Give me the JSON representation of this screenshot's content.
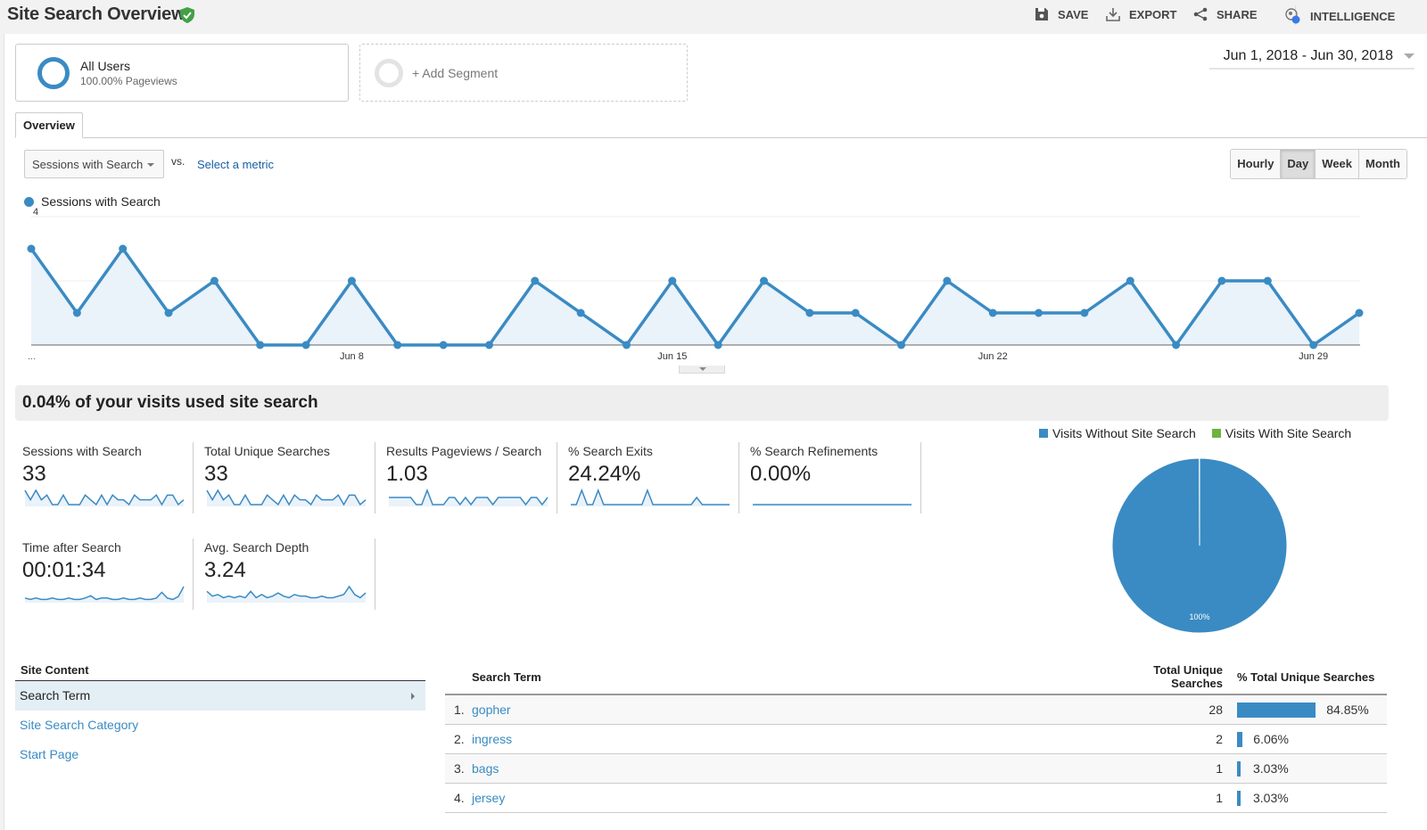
{
  "header": {
    "title": "Site Search Overview",
    "actions": [
      {
        "label": "SAVE",
        "icon": "save-icon"
      },
      {
        "label": "EXPORT",
        "icon": "export-icon"
      },
      {
        "label": "SHARE",
        "icon": "share-icon"
      },
      {
        "label": "INTELLIGENCE",
        "icon": "intelligence-icon"
      }
    ]
  },
  "segments": {
    "primary": {
      "name": "All Users",
      "sub": "100.00% Pageviews"
    },
    "add_label": "+ Add Segment"
  },
  "date_range": "Jun 1, 2018 - Jun 30, 2018",
  "tabs": {
    "overview": "Overview"
  },
  "metric_picker": {
    "selected": "Sessions with Search",
    "vs": "VS.",
    "select_metric": "Select a metric"
  },
  "period_buttons": [
    {
      "label": "Hourly",
      "active": false
    },
    {
      "label": "Day",
      "active": true
    },
    {
      "label": "Week",
      "active": false
    },
    {
      "label": "Month",
      "active": false
    }
  ],
  "colors": {
    "accent": "#3a8bc3",
    "area": "#eaf2fa",
    "green": "#6db33f",
    "link": "#1a5fa6"
  },
  "chart_data": [
    {
      "type": "area",
      "title": "",
      "legend": [
        "Sessions with Search"
      ],
      "x_start_label": "...",
      "x_tick_labels": [
        {
          "index": 7,
          "label": "Jun 8"
        },
        {
          "index": 14,
          "label": "Jun 15"
        },
        {
          "index": 21,
          "label": "Jun 22"
        },
        {
          "index": 28,
          "label": "Jun 29"
        }
      ],
      "y_ticks": [
        2,
        4
      ],
      "ylim": [
        0,
        4
      ],
      "x": [
        "Jun 1",
        "Jun 2",
        "Jun 3",
        "Jun 4",
        "Jun 5",
        "Jun 6",
        "Jun 7",
        "Jun 8",
        "Jun 9",
        "Jun 10",
        "Jun 11",
        "Jun 12",
        "Jun 13",
        "Jun 14",
        "Jun 15",
        "Jun 16",
        "Jun 17",
        "Jun 18",
        "Jun 19",
        "Jun 20",
        "Jun 21",
        "Jun 22",
        "Jun 23",
        "Jun 24",
        "Jun 25",
        "Jun 26",
        "Jun 27",
        "Jun 28",
        "Jun 29",
        "Jun 30"
      ],
      "series": [
        {
          "name": "Sessions with Search",
          "values": [
            3,
            1,
            3,
            1,
            2,
            0,
            0,
            2,
            0,
            0,
            0,
            2,
            1,
            0,
            2,
            0,
            2,
            1,
            1,
            0,
            2,
            1,
            1,
            1,
            2,
            0,
            2,
            2,
            0,
            1
          ]
        }
      ]
    },
    {
      "type": "pie",
      "legend": [
        "Visits Without Site Search",
        "Visits With Site Search"
      ],
      "values": [
        99.96,
        0.04
      ],
      "data_label": "100%"
    }
  ],
  "banner": "0.04% of your visits used site search",
  "kpis": [
    {
      "label": "Sessions with Search",
      "value": "33",
      "spark": [
        3,
        1,
        3,
        1,
        2,
        0,
        0,
        2,
        0,
        0,
        0,
        2,
        1,
        0,
        2,
        0,
        2,
        1,
        1,
        0,
        2,
        1,
        1,
        1,
        2,
        0,
        2,
        2,
        0,
        1
      ]
    },
    {
      "label": "Total Unique Searches",
      "value": "33",
      "spark": [
        3,
        1,
        3,
        1,
        2,
        0,
        0,
        2,
        0,
        0,
        0,
        2,
        1,
        0,
        2,
        0,
        2,
        1,
        1,
        0,
        2,
        1,
        1,
        1,
        2,
        0,
        2,
        2,
        0,
        1
      ]
    },
    {
      "label": "Results Pageviews / Search",
      "value": "1.03",
      "spark": [
        1,
        1,
        1,
        1,
        1,
        0,
        0,
        2,
        0,
        0,
        0,
        1,
        1,
        0,
        1,
        0,
        1,
        1,
        1,
        0,
        1,
        1,
        1,
        1,
        1,
        0,
        1,
        1,
        0,
        1
      ]
    },
    {
      "label": "% Search Exits",
      "value": "24.24%",
      "spark": [
        0,
        0,
        2,
        0,
        0,
        2,
        0,
        0,
        0,
        0,
        0,
        0,
        0,
        0,
        2,
        0,
        0,
        0,
        0,
        0,
        0,
        0,
        0,
        1,
        0,
        0,
        0,
        0,
        0,
        0
      ]
    },
    {
      "label": "% Search Refinements",
      "value": "0.00%",
      "spark": [
        0,
        0,
        0,
        0,
        0,
        0,
        0,
        0,
        0,
        0,
        0,
        0,
        0,
        0,
        0,
        0,
        0,
        0,
        0,
        0,
        0,
        0,
        0,
        0,
        0,
        0,
        0,
        0,
        0,
        0
      ]
    },
    {
      "label": "Time after Search",
      "value": "00:01:34",
      "spark": [
        1,
        0.5,
        1,
        0.5,
        0.5,
        1,
        0.5,
        0.5,
        1,
        0.5,
        0.5,
        1,
        1.8,
        0.5,
        1,
        1,
        0.5,
        0.5,
        1,
        0.5,
        0.5,
        1,
        0.5,
        0.5,
        1,
        3,
        1,
        0.5,
        1.5,
        5
      ]
    },
    {
      "label": "Avg. Search Depth",
      "value": "3.24",
      "spark": [
        3,
        1.5,
        2,
        1,
        1.5,
        1,
        1.5,
        1,
        3,
        1,
        2,
        1,
        1.5,
        2.5,
        1.5,
        1,
        2,
        1.5,
        1.5,
        1,
        1,
        1.5,
        1,
        1,
        1.5,
        2,
        4.5,
        2,
        1,
        2.5
      ]
    }
  ],
  "site_content": {
    "heading": "Site Content",
    "items": [
      {
        "label": "Search Term",
        "active": true
      },
      {
        "label": "Site Search Category",
        "active": false
      },
      {
        "label": "Start Page",
        "active": false
      }
    ]
  },
  "table": {
    "headers": {
      "term": "Search Term",
      "total": "Total Unique Searches",
      "pct": "% Total Unique Searches"
    },
    "rows": [
      {
        "idx": "1.",
        "term": "gopher",
        "count": "28",
        "pct": "84.85%",
        "share": 0.8485
      },
      {
        "idx": "2.",
        "term": "ingress",
        "count": "2",
        "pct": "6.06%",
        "share": 0.0606
      },
      {
        "idx": "3.",
        "term": "bags",
        "count": "1",
        "pct": "3.03%",
        "share": 0.0303
      },
      {
        "idx": "4.",
        "term": "jersey",
        "count": "1",
        "pct": "3.03%",
        "share": 0.0303
      }
    ]
  }
}
